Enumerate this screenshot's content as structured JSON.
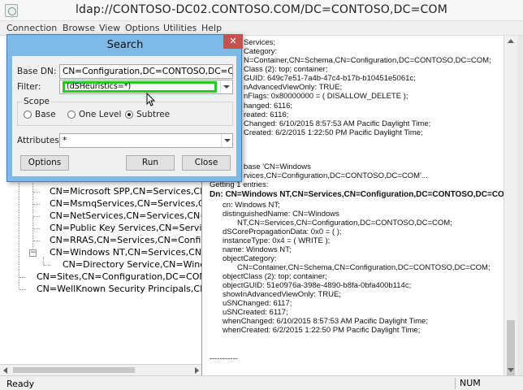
{
  "window": {
    "title": "ldap://CONTOSO-DC02.CONTOSO.COM/DC=CONTOSO,DC=COM"
  },
  "menu": [
    "Connection",
    "Browse",
    "View",
    "Options",
    "Utilities",
    "Help"
  ],
  "tree": [
    "CN=Microsoft SPP,CN=Services,CN=Con",
    "CN=MsmqServices,CN=Services,CN=Cor",
    "CN=NetServices,CN=Services,CN=Config",
    "CN=Public Key Services,CN=Services,CN:",
    "CN=RRAS,CN=Services,CN=Configuratio",
    "CN=Windows NT,CN=Services,CN=Conf",
    "CN=Directory Service,CN=Windows N",
    "CN=Sites,CN=Configuration,DC=CONTOSO,",
    "CN=WellKnown Security Principals,CN=Conf"
  ],
  "output": {
    "top_lines": [
      "Services;",
      "Category:",
      "N=Container,CN=Schema,CN=Configuration,DC=CONTOSO,DC=COM;",
      "Class (2): top; container;",
      "GUID: 649c7e51-7a4b-47c4-b17b-b10451e5061c;",
      "nAdvancedViewOnly: TRUE;",
      "nFlags: 0x80000000 = ( DISALLOW_DELETE );",
      "hanged: 6116;",
      "reated: 6116;",
      "Changed: 6/10/2015 8:57:53 AM Pacific Daylight Time;",
      "Created: 6/2/2015 1:22:50 PM Pacific Daylight Time;"
    ],
    "search_lines": [
      "base 'CN=Windows",
      "rvices,CN=Configuration,DC=CONTOSO,DC=COM'..."
    ],
    "entries_line": "Getting 1 entries:",
    "dn_line": "Dn: CN=Windows NT,CN=Services,CN=Configuration,DC=CONTOSO,DC=COM",
    "attr_lines": [
      "cn: Windows NT;",
      "distinguishedName: CN=Windows",
      "NT,CN=Services,CN=Configuration,DC=CONTOSO,DC=COM;",
      "dSCorePropagationData: 0x0 = (  );",
      "instanceType: 0x4 = ( WRITE );",
      "name: Windows NT;",
      "objectCategory:",
      "CN=Container,CN=Schema,CN=Configuration,DC=CONTOSO,DC=COM;",
      "objectClass (2): top; container;",
      "objectGUID: 51e0976a-398e-4890-b8fa-0bfa400b114c;",
      "showInAdvancedViewOnly: TRUE;",
      "uSNChanged: 6117;",
      "uSNCreated: 6117;",
      "whenChanged: 6/10/2015 8:57:53 AM Pacific Daylight Time;",
      "whenCreated: 6/2/2015 1:22:50 PM Pacific Daylight Time;"
    ],
    "separator": "-----------"
  },
  "dialog": {
    "title": "Search",
    "close": "✕",
    "base_dn_label": "Base DN:",
    "base_dn_value": "CN=Configuration,DC=CONTOSO,DC=COM",
    "filter_label": "Filter:",
    "filter_value": "(dSHeuristics=*)",
    "scope_label": "Scope",
    "scope_options": [
      "Base",
      "One Level",
      "Subtree"
    ],
    "scope_selected": "Subtree",
    "attributes_label": "Attributes:",
    "attributes_value": "*",
    "options_button": "Options",
    "run_button": "Run",
    "close_button": "Close"
  },
  "status": {
    "ready": "Ready",
    "num": "NUM"
  }
}
